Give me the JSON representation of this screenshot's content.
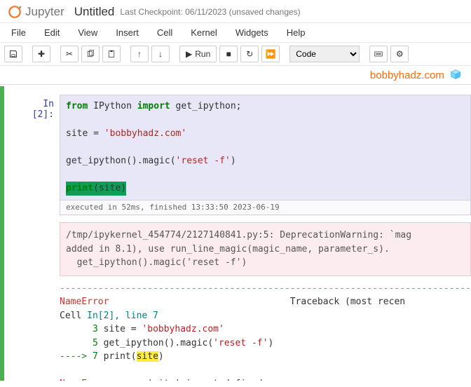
{
  "header": {
    "logo_text": "Jupyter",
    "title": "Untitled",
    "checkpoint": "Last Checkpoint: 06/11/2023  (unsaved changes)"
  },
  "menubar": [
    "File",
    "Edit",
    "View",
    "Insert",
    "Cell",
    "Kernel",
    "Widgets",
    "Help"
  ],
  "toolbar": {
    "run_label": "Run",
    "cell_type": "Code"
  },
  "brand": "bobbyhadz.com",
  "cell": {
    "prompt": "In [2]:",
    "code": {
      "l1_from": "from",
      "l1_mod": " IPython ",
      "l1_import": "import",
      "l1_rest": " get_ipython;",
      "l2_a": "site = ",
      "l2_str": "'bobbyhadz.com'",
      "l3_a": "get_ipython().magic(",
      "l3_str": "'reset -f'",
      "l3_b": ")",
      "l4_print": "print",
      "l4_rest": "(site)"
    },
    "exec_info": "executed in 52ms, finished 13:33:50 2023-06-19",
    "warn": "/tmp/ipykernel_454774/2127140841.py:5: DeprecationWarning: `mag\nadded in 8.1), use run_line_magic(magic_name, parameter_s).\n  get_ipython().magic('reset -f')",
    "traceback": {
      "dashes": "---------------------------------------------------------------------------",
      "name_err": "NameError",
      "tb_label": "                                 Traceback (most recen",
      "cell_line": "Cell ",
      "cell_in": "In[2], line 7",
      "ln3_num": "      3",
      "ln3_code_a": " site = ",
      "ln3_str": "'bobbyhadz.com'",
      "ln5_num": "      5",
      "ln5_code_a": " get_ipython().magic(",
      "ln5_str": "'reset -f'",
      "ln5_code_b": ")",
      "arrow": "----> ",
      "ln7_num": "7",
      "ln7_code_a": " print(",
      "ln7_hl": "site",
      "ln7_code_b": ")",
      "final_a": "NameError",
      "final_b": ": name 'site' is not defined"
    }
  }
}
